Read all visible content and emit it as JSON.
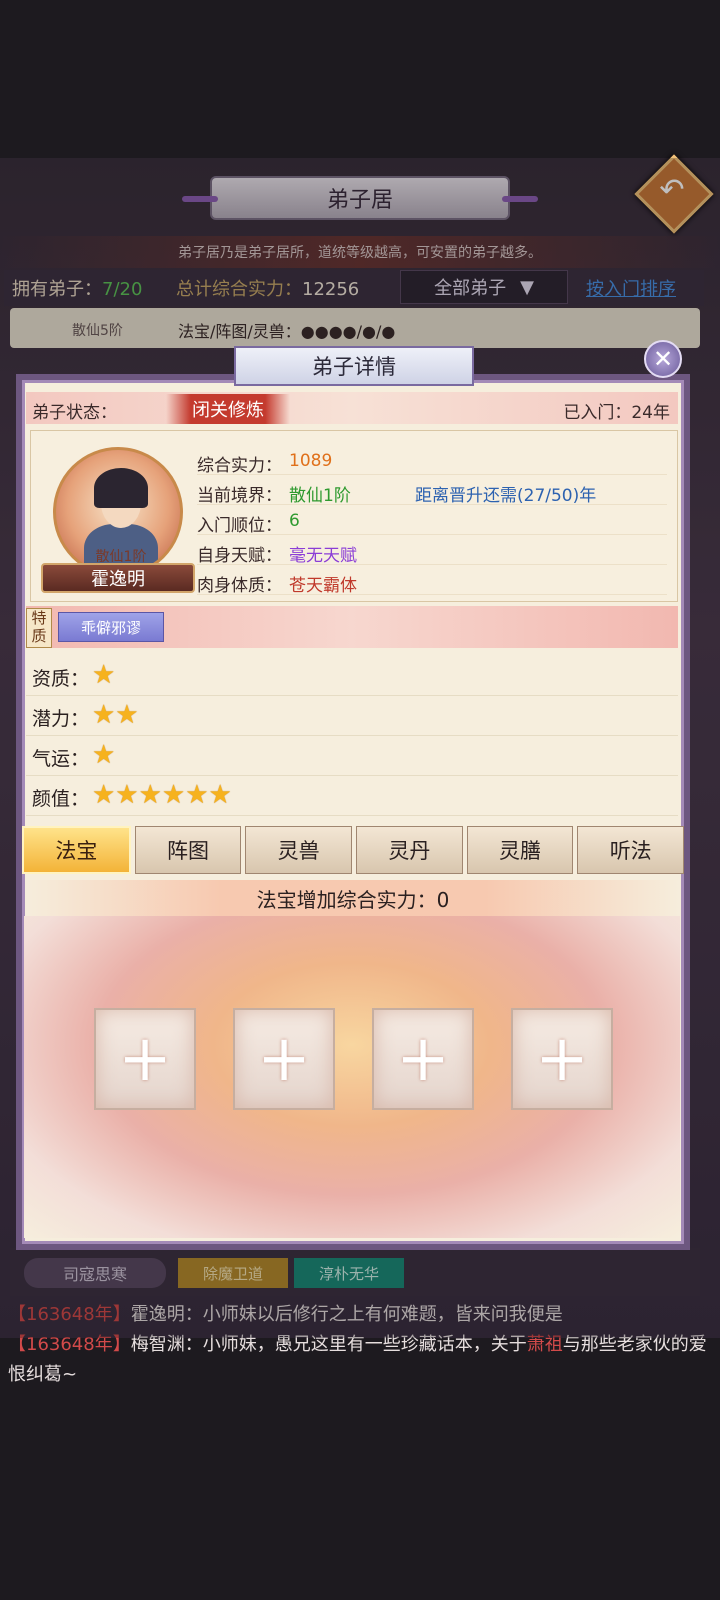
{
  "header": {
    "title": "弟子居",
    "description": "弟子居乃是弟子居所，道统等级越高，可安置的弟子越多。"
  },
  "infobar": {
    "disciples_label": "拥有弟子：",
    "disciples_value": "7/20",
    "power_label": "总计综合实力：",
    "power_value": "12256",
    "filter_value": "全部弟子",
    "sort_label": "按入门排序"
  },
  "background_row": {
    "level": "散仙5阶",
    "equip_label": "法宝/阵图/灵兽：",
    "equip_dots": "●●●●/●/●"
  },
  "background_bottom": {
    "name": "司寇思寒",
    "tag1": "除魔卫道",
    "tag2": "淳朴无华"
  },
  "dialog": {
    "title": "弟子详情",
    "status_label": "弟子状态：",
    "status_value": "闭关修炼",
    "years_label": "已入门：",
    "years_value": "24年",
    "avatar_level": "散仙1阶",
    "name": "霍逸明",
    "stats": [
      {
        "label": "综合实力：",
        "value": "1089",
        "color": "#e0701a"
      },
      {
        "label": "当前境界：",
        "value": "散仙1阶",
        "color": "#2f9a2f",
        "extra": "距离晋升还需(27/50)年"
      },
      {
        "label": "入门顺位：",
        "value": "6",
        "color": "#2f9a2f"
      },
      {
        "label": "自身天赋：",
        "value": "毫无天赋",
        "color": "#8b3dd6"
      },
      {
        "label": "肉身体质：",
        "value": "苍天霸体",
        "color": "#c0392b"
      }
    ],
    "trait_label": "特质",
    "trait_value": "乖僻邪谬",
    "ratings": [
      {
        "label": "资质：",
        "stars": 1
      },
      {
        "label": "潜力：",
        "stars": 2
      },
      {
        "label": "气运：",
        "stars": 1
      },
      {
        "label": "颜值：",
        "stars": 6
      }
    ],
    "tabs": [
      "法宝",
      "阵图",
      "灵兽",
      "灵丹",
      "灵膳",
      "听法"
    ],
    "active_tab": "法宝",
    "bonus_text": "法宝增加综合实力：0",
    "slots": [
      "+",
      "+",
      "+",
      "+"
    ],
    "close_icon": "✕"
  },
  "chat": [
    {
      "time": "【163648年】",
      "speaker": "霍逸明",
      "text": "：小师妹以后修行之上有何难题，皆来问我便是"
    },
    {
      "time": "【163648年】",
      "speaker": "梅智渊",
      "text_before": "：小师妹，愚兄这里有一些珍藏话本，关于",
      "highlight": "萧祖",
      "text_after": "与那些老家伙的爱恨纠葛~"
    }
  ]
}
